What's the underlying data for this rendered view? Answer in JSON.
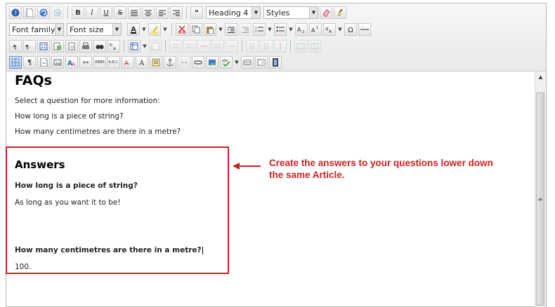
{
  "toolbar": {
    "format_block": "Heading 4",
    "styles": "Styles",
    "font_family": "Font family",
    "font_size": "Font size",
    "bold": "B",
    "italic": "I",
    "underline": "U",
    "strike": "S",
    "text_color_letter": "A",
    "paragraph_mark": "¶"
  },
  "content": {
    "title": "FAQs",
    "intro": "Select a question for more information:",
    "questions": [
      "How long is a piece of string?",
      "How many centimetres are there in a metre?"
    ],
    "answers_heading": "Answers",
    "answers": [
      {
        "q": "How long is a piece of string?",
        "a": "As long as you want it to be!"
      },
      {
        "q": "How many centimetres are there in a metre?",
        "a": "100."
      }
    ]
  },
  "annotation": {
    "text": "Create the answers to your questions lower down the same Article.",
    "color": "#d01f1f"
  }
}
